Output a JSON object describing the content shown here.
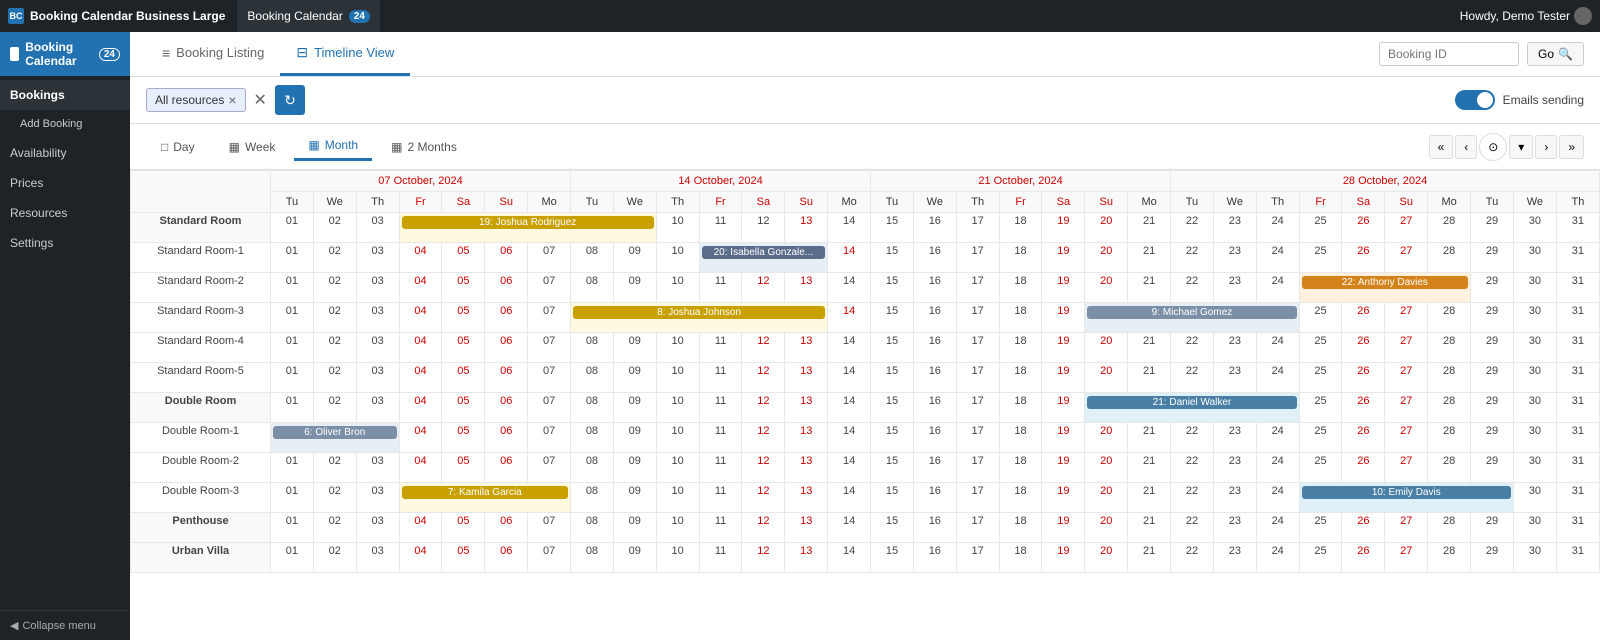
{
  "topbar": {
    "app_title": "Booking Calendar Business Large",
    "tab_label": "Booking Calendar",
    "tab_badge": "24",
    "user": "Howdy, Demo Tester"
  },
  "sidebar": {
    "brand": "Booking Calendar",
    "brand_badge": "24",
    "items": [
      {
        "label": "Bookings",
        "active": true
      },
      {
        "label": "Add Booking",
        "sub": true
      },
      {
        "label": "Availability"
      },
      {
        "label": "Prices"
      },
      {
        "label": "Resources"
      },
      {
        "label": "Settings"
      }
    ],
    "collapse": "Collapse menu"
  },
  "page": {
    "tabs": [
      {
        "label": "Booking Listing",
        "icon": "≡",
        "active": false
      },
      {
        "label": "Timeline View",
        "icon": "⊟",
        "active": true
      }
    ],
    "booking_id_placeholder": "Booking ID",
    "go_label": "Go"
  },
  "filter": {
    "tag": "All resources",
    "emails_sending": "Emails sending"
  },
  "view_tabs": [
    {
      "label": "Day",
      "icon": "□",
      "active": false
    },
    {
      "label": "Week",
      "icon": "▦",
      "active": false
    },
    {
      "label": "Month",
      "icon": "▦",
      "active": true
    },
    {
      "label": "2 Months",
      "icon": "▦",
      "active": false
    }
  ],
  "week_labels": [
    "07 October, 2024",
    "14 October, 2024",
    "21 October, 2024",
    "28 October, 2024"
  ],
  "day_headers": [
    "Tu",
    "We",
    "Th",
    "Fr",
    "Sa",
    "Su",
    "Mo",
    "Tu",
    "We",
    "Th",
    "Fr",
    "Sa",
    "Su",
    "Mo",
    "Tu",
    "We",
    "Th",
    "Fr",
    "Sa",
    "Su",
    "Mo",
    "Tu",
    "We",
    "Th",
    "Fr",
    "Sa",
    "Su",
    "Mo",
    "Tu",
    "We",
    "Th"
  ],
  "day_numbers_std1": [
    "01",
    "02",
    "03",
    "04",
    "05",
    "06",
    "07",
    "08",
    "09",
    "10",
    "11",
    "12",
    "13",
    "14",
    "15",
    "16",
    "17",
    "18",
    "19",
    "20",
    "21",
    "22",
    "23",
    "24",
    "25",
    "26",
    "27",
    "28",
    "29",
    "30",
    "31"
  ],
  "bookings": {
    "joshua_rodriguez": {
      "label": "19: Joshua Rodriguez",
      "row": "standard_room",
      "start": 4,
      "span": 6,
      "class": "booking-yellow"
    },
    "isabella_gonzalez": {
      "label": "20: Isabella Gonzale...",
      "row": "room1",
      "start": 11,
      "span": 3,
      "class": "booking-blue"
    },
    "anthony_davies": {
      "label": "22: Anthony Davies",
      "row": "room2",
      "start": 25,
      "span": 4,
      "class": "booking-orange"
    },
    "joshua_johnson": {
      "label": "8: Joshua Johnson",
      "row": "room3",
      "start": 8,
      "span": 6,
      "class": "booking-yellow"
    },
    "michael_gomez": {
      "label": "9: Michael Gomez",
      "row": "room3",
      "start": 20,
      "span": 5,
      "class": "booking-slate"
    },
    "daniel_walker": {
      "label": "21: Daniel Walker",
      "row": "double_room",
      "start": 20,
      "span": 5,
      "class": "booking-teal"
    },
    "oliver_bron": {
      "label": "6: Oliver Bron",
      "row": "double1",
      "start": 1,
      "span": 3,
      "class": "booking-slate"
    },
    "kamila_garcia": {
      "label": "7: Kamila Garcia",
      "row": "double3",
      "start": 4,
      "span": 4,
      "class": "booking-yellow"
    },
    "emily_davis": {
      "label": "10: Emily Davis",
      "row": "double3",
      "start": 25,
      "span": 5,
      "class": "booking-teal"
    }
  },
  "resources": [
    {
      "id": "standard_room",
      "label": "Standard Room",
      "is_group": true
    },
    {
      "id": "room1",
      "label": "Standard Room-1",
      "is_sub": true
    },
    {
      "id": "room2",
      "label": "Standard Room-2",
      "is_sub": true
    },
    {
      "id": "room3",
      "label": "Standard Room-3",
      "is_sub": true
    },
    {
      "id": "room4",
      "label": "Standard Room-4",
      "is_sub": true
    },
    {
      "id": "room5",
      "label": "Standard Room-5",
      "is_sub": true
    },
    {
      "id": "double_room",
      "label": "Double Room",
      "is_group": true
    },
    {
      "id": "double1",
      "label": "Double Room-1",
      "is_sub": true
    },
    {
      "id": "double2",
      "label": "Double Room-2",
      "is_sub": true
    },
    {
      "id": "double3",
      "label": "Double Room-3",
      "is_sub": true
    },
    {
      "id": "penthouse",
      "label": "Penthouse",
      "is_group": true
    },
    {
      "id": "urban_villa",
      "label": "Urban Villa",
      "is_group": true
    }
  ]
}
